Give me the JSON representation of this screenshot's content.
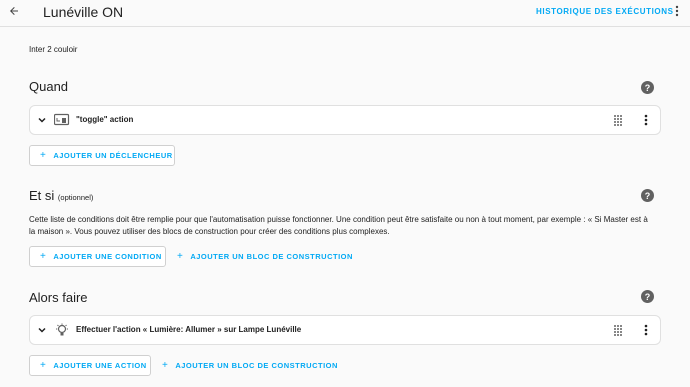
{
  "header": {
    "title": "Lunéville ON",
    "history_label": "HISTORIQUE DES EXÉCUTIONS"
  },
  "automation": {
    "description": "Inter 2 couloir"
  },
  "triggers": {
    "title": "Quand",
    "items": [
      {
        "label": "\"toggle\" action",
        "icon": "remote-device-icon"
      }
    ],
    "add_label": "AJOUTER UN DÉCLENCHEUR"
  },
  "conditions": {
    "title": "Et si",
    "optional_label": "(optionnel)",
    "description": "Cette liste de conditions doit être remplie pour que l'automatisation puisse fonctionner. Une condition peut être satisfaite ou non à tout moment, par exemple : « Si Master est à la maison ». Vous pouvez utiliser des blocs de construction pour créer des conditions plus complexes.",
    "add_label": "AJOUTER UNE CONDITION",
    "add_block_label": "AJOUTER UN BLOC DE CONSTRUCTION"
  },
  "actions": {
    "title": "Alors faire",
    "items": [
      {
        "label": "Effectuer l'action « Lumière: Allumer » sur Lampe Lunéville",
        "icon": "lightbulb-icon"
      }
    ],
    "add_label": "AJOUTER UNE ACTION",
    "add_block_label": "AJOUTER UN BLOC DE CONSTRUCTION"
  },
  "help_glyph": "?",
  "plus_glyph": "+",
  "colors": {
    "accent": "#03a9f4",
    "help_bg": "#616161",
    "background": "#fafafa"
  }
}
